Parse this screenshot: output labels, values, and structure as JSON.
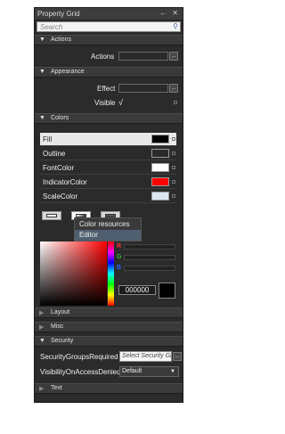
{
  "panel": {
    "title": "Property Grid",
    "title_buttons": "← ✕",
    "search_placeholder": "Search",
    "search_icon": "search-icon"
  },
  "categories": {
    "actions": "Actions",
    "appearance": "Appearance",
    "colors": "Colors",
    "layout": "Layout",
    "misc": "Misc",
    "security": "Security",
    "text": "Text"
  },
  "props": {
    "actions_label": "Actions",
    "effect_label": "Effect",
    "visible_label": "Visible",
    "visible_value": "√",
    "editor_button": "..."
  },
  "color_rows": [
    {
      "label": "Fill",
      "color": "#000000"
    },
    {
      "label": "Outline",
      "color": "#2b2b2b"
    },
    {
      "label": "FontColor",
      "color": "#ffffff"
    },
    {
      "label": "IndicatorColor",
      "color": "#ff0000"
    },
    {
      "label": "ScaleColor",
      "color": "#dce6f0"
    }
  ],
  "context_menu": {
    "item1": "Color resources",
    "item2": "Editor"
  },
  "picker": {
    "channels": [
      "R",
      "G",
      "B"
    ],
    "channel_colors": [
      "#ff3030",
      "#30c030",
      "#3060ff"
    ],
    "hex_value": "000000",
    "preview_color": "#000000"
  },
  "security": {
    "groups_label": "SecurityGroupsRequired",
    "groups_placeholder": "Select Security Gr",
    "visibility_label": "VisibilityOnAccessDenied",
    "visibility_value": "Default"
  }
}
